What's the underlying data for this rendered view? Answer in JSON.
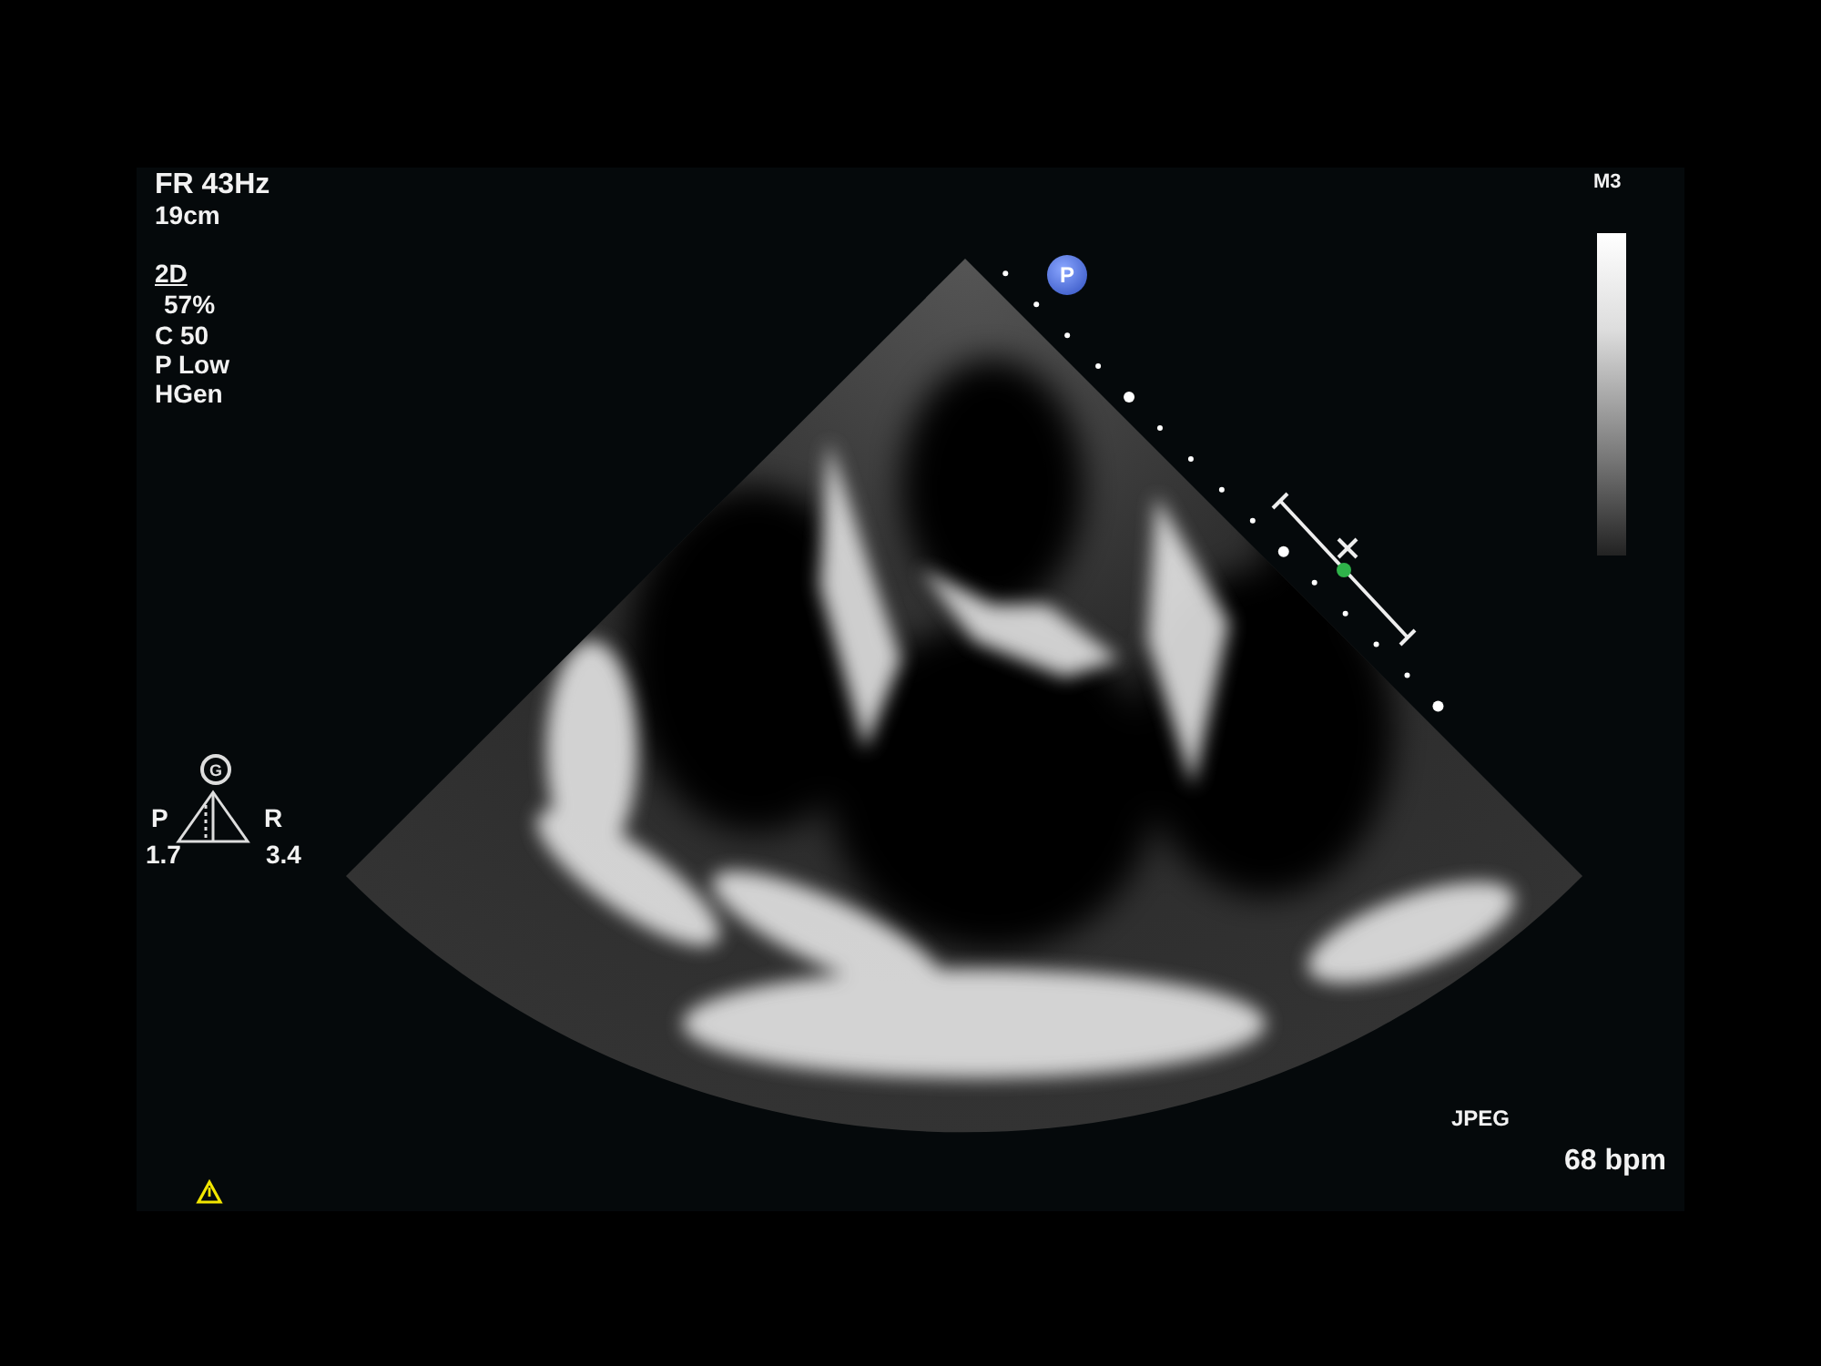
{
  "header": {
    "frame_rate": "FR 43Hz",
    "depth": "19cm"
  },
  "mode": {
    "label": "2D",
    "gain": "57%",
    "compress": "C 50",
    "power": "P Low",
    "frequency": "HGen"
  },
  "focus_indicator": {
    "badge": "G",
    "left_label": "P",
    "right_label": "R",
    "left_value": "1.7",
    "right_value": "3.4"
  },
  "orientation_marker": "P",
  "grayscale_map": "M3",
  "format": "JPEG",
  "heart_rate": "68 bpm"
}
